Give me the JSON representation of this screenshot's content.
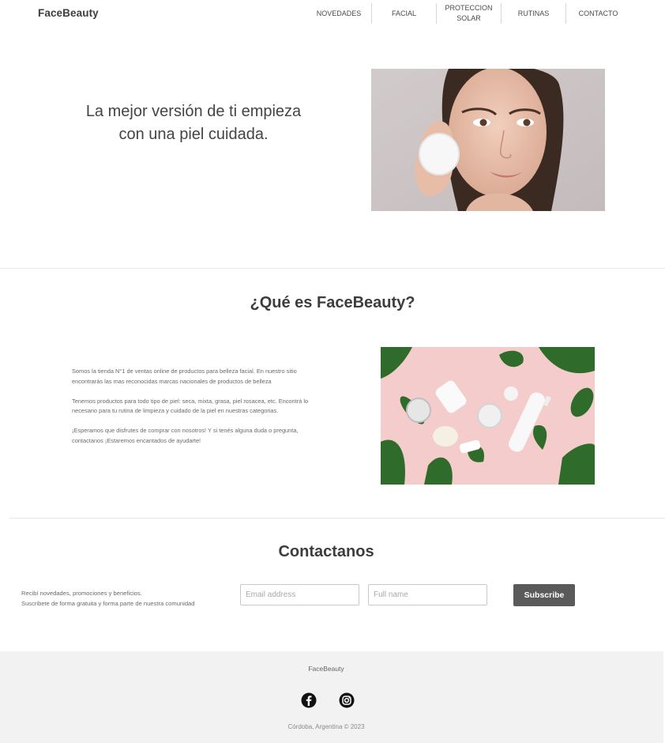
{
  "header": {
    "brand": "FaceBeauty",
    "nav": [
      {
        "label": "NOVEDADES"
      },
      {
        "label": "FACIAL"
      },
      {
        "label": "PROTECCION SOLAR"
      },
      {
        "label": "RUTINAS"
      },
      {
        "label": "CONTACTO"
      }
    ]
  },
  "hero": {
    "headline": "La mejor versión de ti empieza con una piel cuidada."
  },
  "about": {
    "title": "¿Qué es FaceBeauty?",
    "paragraphs": [
      "Somos la tienda N°1 de ventas online de productos para belleza facial. En nuestro sitio encontrarás las mas reconocidas marcas nacionales de productos de belleza",
      "Tenemos productos para todo tipo de piel: seca, mixta, grasa, piel rosacea, etc. Encontrá lo necesario para tu rutina de limpieza y cuidado de la piel en nuestras categorias.",
      "¡Esperamos que disfrutes de comprar con nosotros! Y si tenés alguna duda o pregunta, contactanos ¡Estaremos encantados de ayudarte!"
    ]
  },
  "contact": {
    "title": "Contactanos",
    "note_line1": "Recibí novedades, promociones y beneficios.",
    "note_line2": "Suscribete de forma gratuita y forma parte de nuestra comunidad",
    "email_placeholder": "Email address",
    "email_value": "",
    "name_placeholder": "Full name",
    "name_value": "",
    "subscribe_label": "Subscribe"
  },
  "footer": {
    "brand": "FaceBeauty",
    "icons": [
      "facebook-icon",
      "instagram-icon"
    ],
    "copyright": "Córdoba, Argentina © 2023"
  }
}
